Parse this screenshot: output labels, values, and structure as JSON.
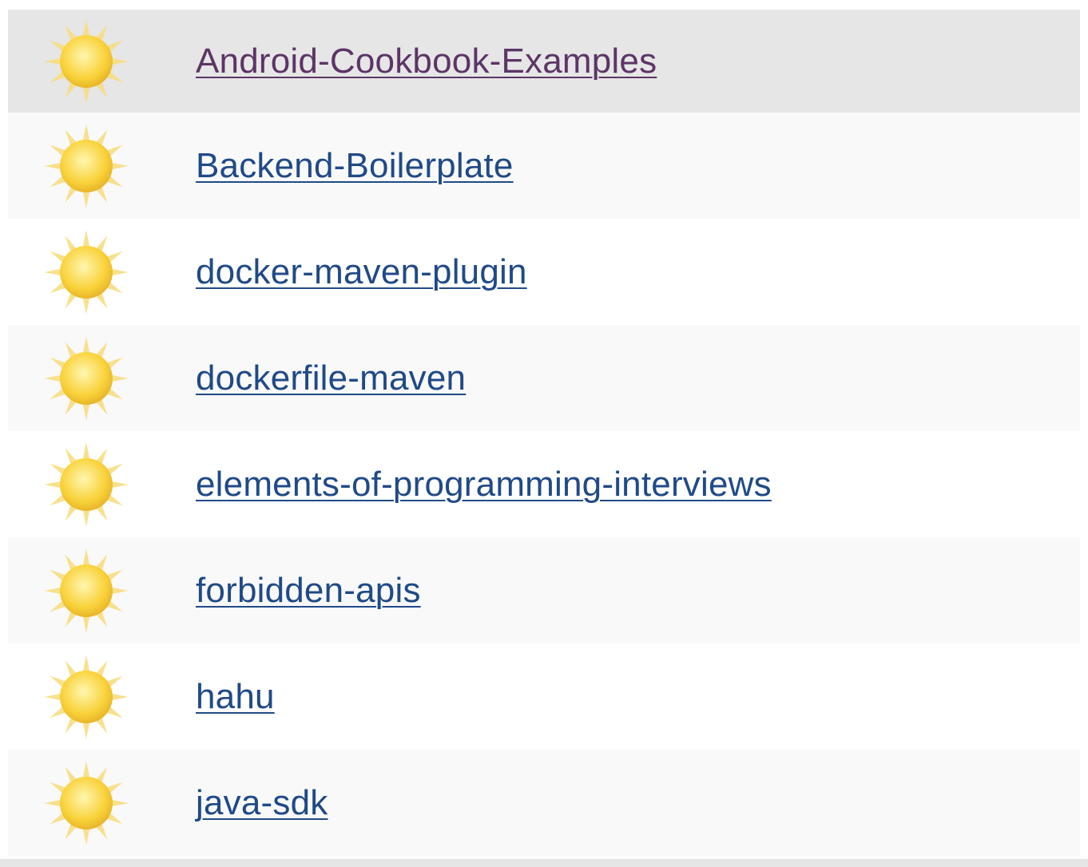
{
  "jobs": [
    {
      "name": "Android-Cookbook-Examples",
      "status_icon": "sunny-weather-icon",
      "visited": true
    },
    {
      "name": "Backend-Boilerplate",
      "status_icon": "sunny-weather-icon"
    },
    {
      "name": "docker-maven-plugin",
      "status_icon": "sunny-weather-icon"
    },
    {
      "name": "dockerfile-maven",
      "status_icon": "sunny-weather-icon"
    },
    {
      "name": "elements-of-programming-interviews",
      "status_icon": "sunny-weather-icon"
    },
    {
      "name": "forbidden-apis",
      "status_icon": "sunny-weather-icon"
    },
    {
      "name": "hahu",
      "status_icon": "sunny-weather-icon"
    },
    {
      "name": "java-sdk",
      "status_icon": "sunny-weather-icon"
    }
  ],
  "colors": {
    "link": "#204a87",
    "visited_link": "#5c3566",
    "selected_row": "#e6e6e6",
    "alt_row": "#f9f9fa",
    "sun_core": "#f9d23a",
    "sun_rays": "#f7dc7a"
  }
}
